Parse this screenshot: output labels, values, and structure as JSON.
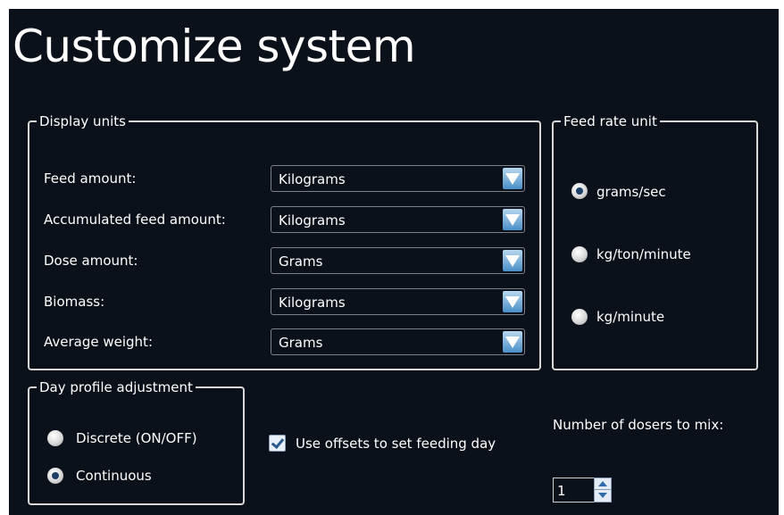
{
  "page": {
    "title": "Customize system"
  },
  "display_units": {
    "legend": "Display units",
    "rows": [
      {
        "label": "Feed amount:",
        "value": "Kilograms"
      },
      {
        "label": "Accumulated feed amount:",
        "value": "Kilograms"
      },
      {
        "label": "Dose amount:",
        "value": "Grams"
      },
      {
        "label": "Biomass:",
        "value": "Kilograms"
      },
      {
        "label": "Average weight:",
        "value": "Grams"
      }
    ]
  },
  "feed_rate_unit": {
    "legend": "Feed rate unit",
    "options": [
      {
        "label": "grams/sec",
        "selected": true
      },
      {
        "label": "kg/ton/minute",
        "selected": false
      },
      {
        "label": "kg/minute",
        "selected": false
      }
    ]
  },
  "day_profile": {
    "legend": "Day profile adjustment",
    "options": [
      {
        "label": "Discrete (ON/OFF)",
        "selected": false
      },
      {
        "label": "Continuous",
        "selected": true
      }
    ]
  },
  "offsets": {
    "label": "Use offsets to set feeding day",
    "checked": true
  },
  "dosers": {
    "label": "Number of dosers to mix:",
    "value": "1"
  },
  "colors": {
    "background": "#0b111b",
    "accent": "#4a8fc8",
    "text": "#ffffff"
  },
  "icons": {
    "select_arrow": "chevron-down-icon",
    "spinner": "up-down-arrows-icon"
  }
}
